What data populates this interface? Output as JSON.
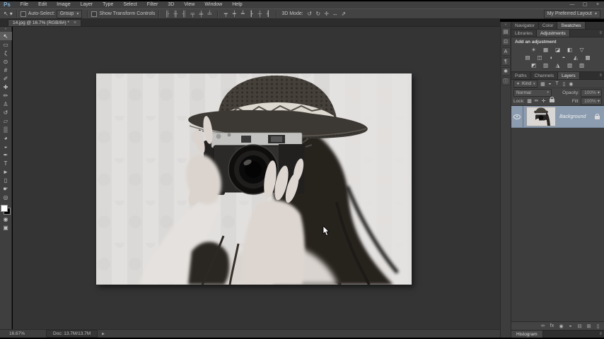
{
  "ui": {
    "caret_glyph": "▾",
    "collapse_glyph": "«",
    "expand_glyph": "»",
    "panel_menu_glyph": "≡",
    "flyout_glyph": "▶"
  },
  "menubar": {
    "logo": "Ps",
    "items": [
      {
        "name": "menu-file",
        "label": "File"
      },
      {
        "name": "menu-edit",
        "label": "Edit"
      },
      {
        "name": "menu-image",
        "label": "Image"
      },
      {
        "name": "menu-layer",
        "label": "Layer"
      },
      {
        "name": "menu-type",
        "label": "Type"
      },
      {
        "name": "menu-select",
        "label": "Select"
      },
      {
        "name": "menu-filter",
        "label": "Filter"
      },
      {
        "name": "menu-3d",
        "label": "3D"
      },
      {
        "name": "menu-view",
        "label": "View"
      },
      {
        "name": "menu-window",
        "label": "Window"
      },
      {
        "name": "menu-help",
        "label": "Help"
      }
    ]
  },
  "window_controls": [
    {
      "name": "minimize-button",
      "glyph": "—"
    },
    {
      "name": "restore-button",
      "glyph": "▢"
    },
    {
      "name": "close-button",
      "glyph": "×"
    }
  ],
  "options_bar": {
    "tool_glyph": "↖",
    "auto_select_label": "Auto-Select:",
    "group_value": "Group",
    "show_transform_label": "Show Transform Controls",
    "align_icons": [
      {
        "name": "align-left-edges-icon",
        "glyph": "╟"
      },
      {
        "name": "align-horizontal-centers-icon",
        "glyph": "╫"
      },
      {
        "name": "align-right-edges-icon",
        "glyph": "╢"
      },
      {
        "name": "align-top-edges-icon",
        "glyph": "╤"
      },
      {
        "name": "align-vertical-centers-icon",
        "glyph": "╪"
      },
      {
        "name": "align-bottom-edges-icon",
        "glyph": "╧"
      }
    ],
    "distribute_icons": [
      {
        "name": "distribute-top-edges-icon",
        "glyph": "┯"
      },
      {
        "name": "distribute-vertical-centers-icon",
        "glyph": "┿"
      },
      {
        "name": "distribute-bottom-edges-icon",
        "glyph": "┷"
      },
      {
        "name": "distribute-left-edges-icon",
        "glyph": "┠"
      },
      {
        "name": "distribute-horizontal-centers-icon",
        "glyph": "┼"
      },
      {
        "name": "distribute-right-edges-icon",
        "glyph": "┨"
      }
    ],
    "mode_label": "3D Mode:",
    "mode_icons": [
      {
        "name": "3d-rotate-icon",
        "glyph": "↺"
      },
      {
        "name": "3d-roll-icon",
        "glyph": "↻"
      },
      {
        "name": "3d-drag-icon",
        "glyph": "✛"
      },
      {
        "name": "3d-slide-icon",
        "glyph": "↔"
      },
      {
        "name": "3d-scale-icon",
        "glyph": "⇗"
      }
    ],
    "workspace_value": "My Preferred Layout"
  },
  "document_tab": {
    "title": "14.jpg @ 16.7% (RGB/8#) *",
    "close_glyph": "×"
  },
  "toolbar": {
    "tools": [
      {
        "name": "move-tool",
        "glyph": "↖",
        "selected": true
      },
      {
        "name": "rectangular-marquee-tool",
        "glyph": "▭"
      },
      {
        "name": "lasso-tool",
        "glyph": "ζ"
      },
      {
        "name": "quick-selection-tool",
        "glyph": "⊙"
      },
      {
        "name": "crop-tool",
        "glyph": "#"
      },
      {
        "name": "eyedropper-tool",
        "glyph": "✐"
      },
      {
        "name": "spot-healing-brush-tool",
        "glyph": "✚"
      },
      {
        "name": "brush-tool",
        "glyph": "✏"
      },
      {
        "name": "clone-stamp-tool",
        "glyph": "♙"
      },
      {
        "name": "history-brush-tool",
        "glyph": "↺"
      },
      {
        "name": "eraser-tool",
        "glyph": "▱"
      },
      {
        "name": "gradient-tool",
        "glyph": "▒"
      },
      {
        "name": "blur-tool",
        "glyph": "◕"
      },
      {
        "name": "dodge-tool",
        "glyph": "◒"
      },
      {
        "name": "pen-tool",
        "glyph": "✒"
      },
      {
        "name": "type-tool",
        "glyph": "T"
      },
      {
        "name": "path-selection-tool",
        "glyph": "►"
      },
      {
        "name": "rectangle-tool",
        "glyph": "▯"
      },
      {
        "name": "hand-tool",
        "glyph": "☛"
      },
      {
        "name": "zoom-tool",
        "glyph": "◎"
      }
    ],
    "quick_mask_glyph": "◉",
    "screen_mode_glyph": "▣",
    "foreground_color": "#ffffff",
    "background_color": "#000000"
  },
  "side_strip": [
    {
      "name": "properties-panel-icon",
      "glyph": "▤"
    },
    {
      "name": "clone-source-panel-icon",
      "glyph": "⊡"
    },
    {
      "name": "character-panel-icon",
      "glyph": "A"
    },
    {
      "name": "paragraph-panel-icon",
      "glyph": "¶"
    },
    {
      "name": "brush-settings-panel-icon",
      "glyph": "✱"
    },
    {
      "name": "info-panel-icon",
      "glyph": "ⓘ"
    }
  ],
  "panels": {
    "nav_tabs": [
      {
        "name": "tab-navigator",
        "label": "Navigator"
      },
      {
        "name": "tab-color",
        "label": "Color"
      },
      {
        "name": "tab-swatches",
        "label": "Swatches",
        "active": true
      }
    ],
    "lib_tabs": [
      {
        "name": "tab-libraries",
        "label": "Libraries"
      },
      {
        "name": "tab-adjustments",
        "label": "Adjustments",
        "active": true
      }
    ],
    "adjustments": {
      "header": "Add an adjustment",
      "row1": [
        {
          "name": "adj-brightness-contrast-icon",
          "glyph": "☀"
        },
        {
          "name": "adj-levels-icon",
          "glyph": "▦"
        },
        {
          "name": "adj-curves-icon",
          "glyph": "◪"
        },
        {
          "name": "adj-exposure-icon",
          "glyph": "◧"
        },
        {
          "name": "adj-vibrance-icon",
          "glyph": "▽"
        }
      ],
      "row2": [
        {
          "name": "adj-hue-saturation-icon",
          "glyph": "▤"
        },
        {
          "name": "adj-color-balance-icon",
          "glyph": "◫"
        },
        {
          "name": "adj-black-white-icon",
          "glyph": "◐"
        },
        {
          "name": "adj-photo-filter-icon",
          "glyph": "◓"
        },
        {
          "name": "adj-channel-mixer-icon",
          "glyph": "◭"
        },
        {
          "name": "adj-color-lookup-icon",
          "glyph": "▩"
        }
      ],
      "row3": [
        {
          "name": "adj-invert-icon",
          "glyph": "◩"
        },
        {
          "name": "adj-posterize-icon",
          "glyph": "▥"
        },
        {
          "name": "adj-threshold-icon",
          "glyph": "◮"
        },
        {
          "name": "adj-selective-color-icon",
          "glyph": "▧"
        },
        {
          "name": "adj-gradient-map-icon",
          "glyph": "▨"
        }
      ]
    },
    "layer_tabs": [
      {
        "name": "tab-paths",
        "label": "Paths"
      },
      {
        "name": "tab-channels",
        "label": "Channels"
      },
      {
        "name": "tab-layers",
        "label": "Layers",
        "active": true
      }
    ],
    "filter_row": {
      "funnel_glyph": "▼",
      "kind_label": "Kind",
      "icons": [
        {
          "name": "filter-pixel-layers-icon",
          "glyph": "▦"
        },
        {
          "name": "filter-adjustment-layers-icon",
          "glyph": "◒"
        },
        {
          "name": "filter-type-layers-icon",
          "glyph": "T"
        },
        {
          "name": "filter-shape-layers-icon",
          "glyph": "▯"
        },
        {
          "name": "filter-smart-objects-icon",
          "glyph": "◉"
        }
      ]
    },
    "blend_row": {
      "mode": "Normal",
      "opacity_label": "Opacity:",
      "opacity_value": "100%"
    },
    "lock_row": {
      "label": "Lock:",
      "icons": [
        {
          "name": "lock-transparency-icon",
          "glyph": "▩"
        },
        {
          "name": "lock-pixels-icon",
          "glyph": "✏"
        },
        {
          "name": "lock-position-icon",
          "glyph": "✛"
        }
      ],
      "fill_label": "Fill:",
      "fill_value": "100%"
    },
    "layers": [
      {
        "name": "layer-row-background",
        "label": "Background",
        "selected": true
      }
    ],
    "bottom_icons": [
      {
        "name": "link-layers-icon",
        "glyph": "∞"
      },
      {
        "name": "layer-effects-icon",
        "glyph": "fx"
      },
      {
        "name": "add-layer-mask-icon",
        "glyph": "◉"
      },
      {
        "name": "new-adjustment-layer-icon",
        "glyph": "◒"
      },
      {
        "name": "new-group-icon",
        "glyph": "⊟"
      },
      {
        "name": "new-layer-icon",
        "glyph": "⊞"
      },
      {
        "name": "delete-layer-icon",
        "glyph": "▯"
      }
    ],
    "histogram_tab": "Histogram"
  },
  "status_bar": {
    "zoom": "16.67%",
    "doc": "Doc: 13.7M/13.7M"
  },
  "colors": {
    "selected_layer": "#8b9cb0",
    "logo_blue": "#7ab3dd",
    "pasteboard": "#343434"
  }
}
